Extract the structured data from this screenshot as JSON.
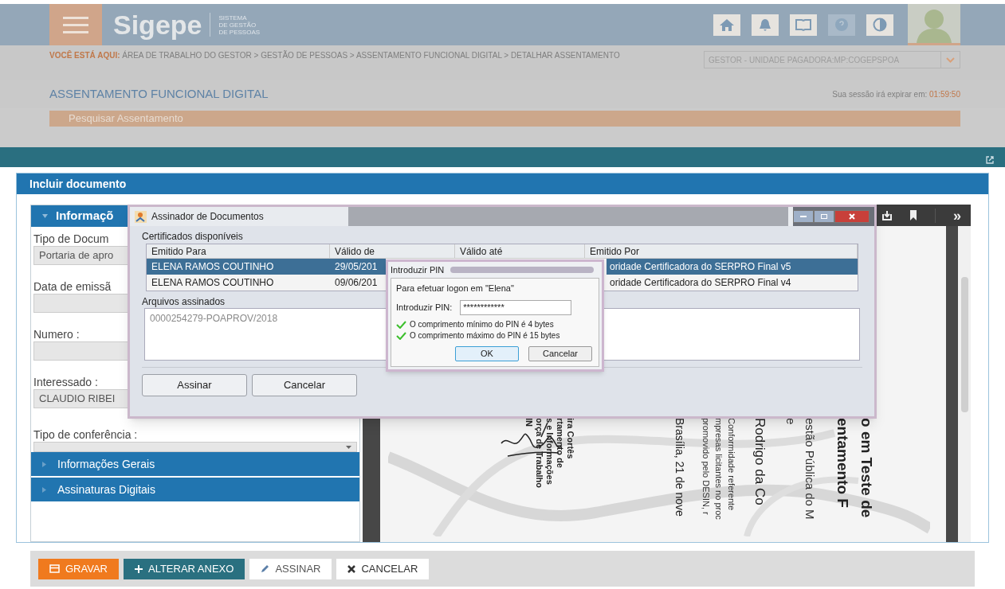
{
  "header": {
    "logo": "Sigepe",
    "subtitle": [
      "SISTEMA",
      "DE GESTÃO",
      "DE PESSOAS"
    ]
  },
  "breadcrumb": {
    "label": "VOCÊ ESTÁ AQUI:",
    "separator": ">",
    "items": [
      "ÁREA DE TRABALHO DO GESTOR",
      "GESTÃO DE PESSOAS",
      "ASSENTAMENTO FUNCIONAL DIGITAL",
      "DETALHAR ASSENTAMENTO"
    ]
  },
  "profile_select": "GESTOR - UNIDADE PAGADORA:MP:COGEPSPOA",
  "page_title": "ASSENTAMENTO FUNCIONAL DIGITAL",
  "session": {
    "label": "Sua sessão irá expirar em:",
    "time": "01:59:50"
  },
  "search_tab": "Pesquisar Assentamento",
  "panel": {
    "title": "Incluir documento"
  },
  "form": {
    "section": {
      "title": "Informaçõ",
      "expanded": true
    },
    "fields": [
      {
        "kind": "text",
        "label": "Tipo de Docum",
        "value": "Portaria de apro"
      },
      {
        "kind": "text",
        "label": "Data de emissã"
      },
      {
        "kind": "text",
        "label": "Numero :"
      },
      {
        "kind": "text",
        "label": "Interessado :",
        "value": "CLAUDIO RIBEI"
      },
      {
        "kind": "select",
        "label": "Tipo de conferência :"
      }
    ],
    "accordions": [
      {
        "title": "Informações Gerais",
        "expanded": false
      },
      {
        "title": "Assinaturas Digitais",
        "expanded": false
      }
    ]
  },
  "viewer": {
    "more": "»",
    "document": {
      "groups": [
        {
          "kind": "heading",
          "lines": [
            "o em Teste de",
            "entamento F"
          ]
        },
        {
          "kind": "subheading",
          "lines": [
            "estão Pública do M",
            "e"
          ]
        },
        {
          "kind": "name",
          "lines": [
            "Rodrigo da Co"
          ]
        },
        {
          "kind": "body",
          "lines": [
            "Conformidade referente",
            "mpresas licitantes no proc",
            "promovido pelo DESIN, r"
          ]
        },
        {
          "kind": "date",
          "lines": [
            "Brasília, 21 de nove"
          ]
        },
        {
          "kind": "signature",
          "lines": [
            "ira Cortês",
            "rtamento de",
            "s e Informações",
            "orça de Trabalho",
            "IN"
          ]
        }
      ]
    }
  },
  "signer_dialog": {
    "title": "Assinador de Documentos",
    "certificates_label": "Certificados disponíveis",
    "columns": [
      "Emitido Para",
      "Válido de",
      "Válido até",
      "Emitido Por"
    ],
    "rows": [
      {
        "selected": true,
        "cells": [
          "ELENA RAMOS COUTINHO",
          "29/05/201",
          "oridade Certificadora do SERPRO Final v5"
        ]
      },
      {
        "selected": false,
        "cells": [
          "ELENA RAMOS COUTINHO",
          "09/06/201",
          "oridade Certificadora do SERPRO Final v4"
        ]
      }
    ],
    "files_label": "Arquivos assinados",
    "files": [
      "0000254279-POAPROV/2018"
    ],
    "buttons": [
      "Assinar",
      "Cancelar"
    ]
  },
  "pin_dialog": {
    "title": "Introduzir PIN",
    "message": "Para efetuar logon em \"Elena\"",
    "pin_label": "Introduzir PIN:",
    "pin_value": "************",
    "rules": [
      {
        "text": "O comprimento mínimo do PIN é 4 bytes",
        "ok": true
      },
      {
        "text": "O comprimento máximo do PIN é 15 bytes",
        "ok": true
      }
    ],
    "buttons": [
      "OK",
      "Cancelar"
    ]
  },
  "actions": [
    {
      "kind": "save",
      "label": "GRAVAR"
    },
    {
      "kind": "add",
      "label": "ALTERAR ANEXO"
    },
    {
      "kind": "sign",
      "label": "ASSINAR"
    },
    {
      "kind": "cancel",
      "label": "CANCELAR"
    }
  ]
}
